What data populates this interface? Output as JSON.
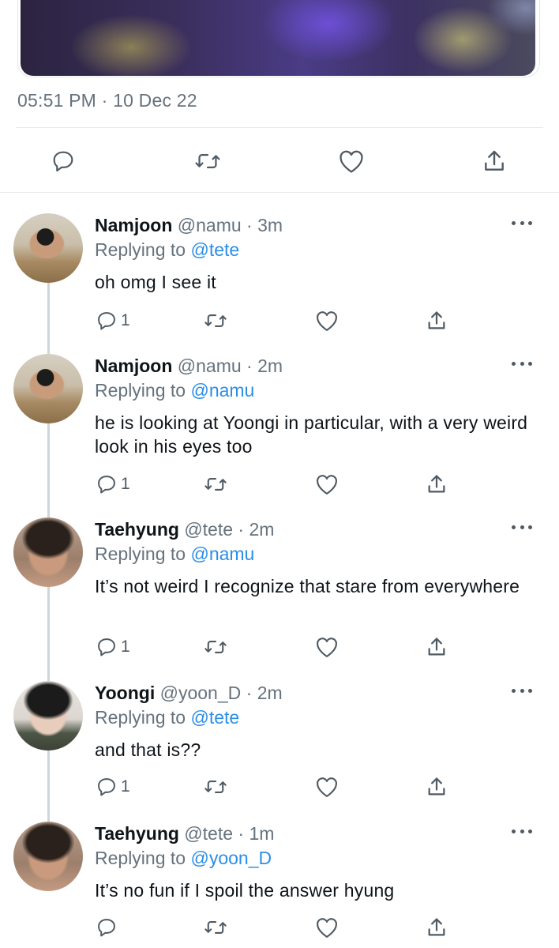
{
  "tweet": {
    "timestamp": "05:51 PM · 10 Dec 22"
  },
  "main_actions": {
    "icons": [
      "reply-icon",
      "retweet-icon",
      "like-icon",
      "share-icon"
    ]
  },
  "replies": [
    {
      "name": "Namjoon",
      "handle": "@namu",
      "time": "3m",
      "meta": "@namu · 3m",
      "replying_prefix": "Replying to",
      "replying_to": "@tete",
      "text": "oh omg I see it",
      "reply_count": "1"
    },
    {
      "name": "Namjoon",
      "handle": "@namu",
      "time": "2m",
      "meta": "@namu · 2m",
      "replying_prefix": "Replying to",
      "replying_to": "@namu",
      "text": "he is looking at Yoongi in particular, with a very weird look in his eyes too",
      "reply_count": "1"
    },
    {
      "name": "Taehyung",
      "handle": "@tete",
      "time": "2m",
      "meta": "@tete · 2m",
      "replying_prefix": "Replying to",
      "replying_to": "@namu",
      "text": "It’s not weird I recognize that stare from everywhere",
      "reply_count": "1"
    },
    {
      "name": "Yoongi",
      "handle": "@yoon_D",
      "time": "2m",
      "meta": "@yoon_D · 2m",
      "replying_prefix": "Replying to",
      "replying_to": "@tete",
      "text": "and that is??",
      "reply_count": "1"
    },
    {
      "name": "Taehyung",
      "handle": "@tete",
      "time": "1m",
      "meta": "@tete · 1m",
      "replying_prefix": "Replying to",
      "replying_to": "@yoon_D",
      "text": "It’s no fun if I spoil the answer hyung",
      "reply_count": ""
    }
  ],
  "colors": {
    "accent": "#2b8ee8",
    "text": "#0f1419",
    "secondary": "#66727d",
    "divider": "#e6e9eb"
  }
}
